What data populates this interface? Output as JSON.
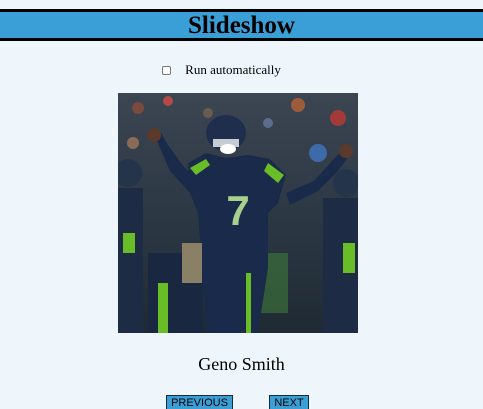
{
  "header": {
    "title": "Slideshow"
  },
  "controls": {
    "auto_label": "Run automatically",
    "auto_checked": false
  },
  "slide": {
    "caption": "Geno Smith",
    "jersey_number": "7"
  },
  "nav": {
    "previous_label": "PREVIOUS",
    "next_label": "NEXT"
  },
  "colors": {
    "header_bg": "#3a9fd6",
    "page_bg": "#eef6fb",
    "button_bg": "#3a9fd6"
  }
}
